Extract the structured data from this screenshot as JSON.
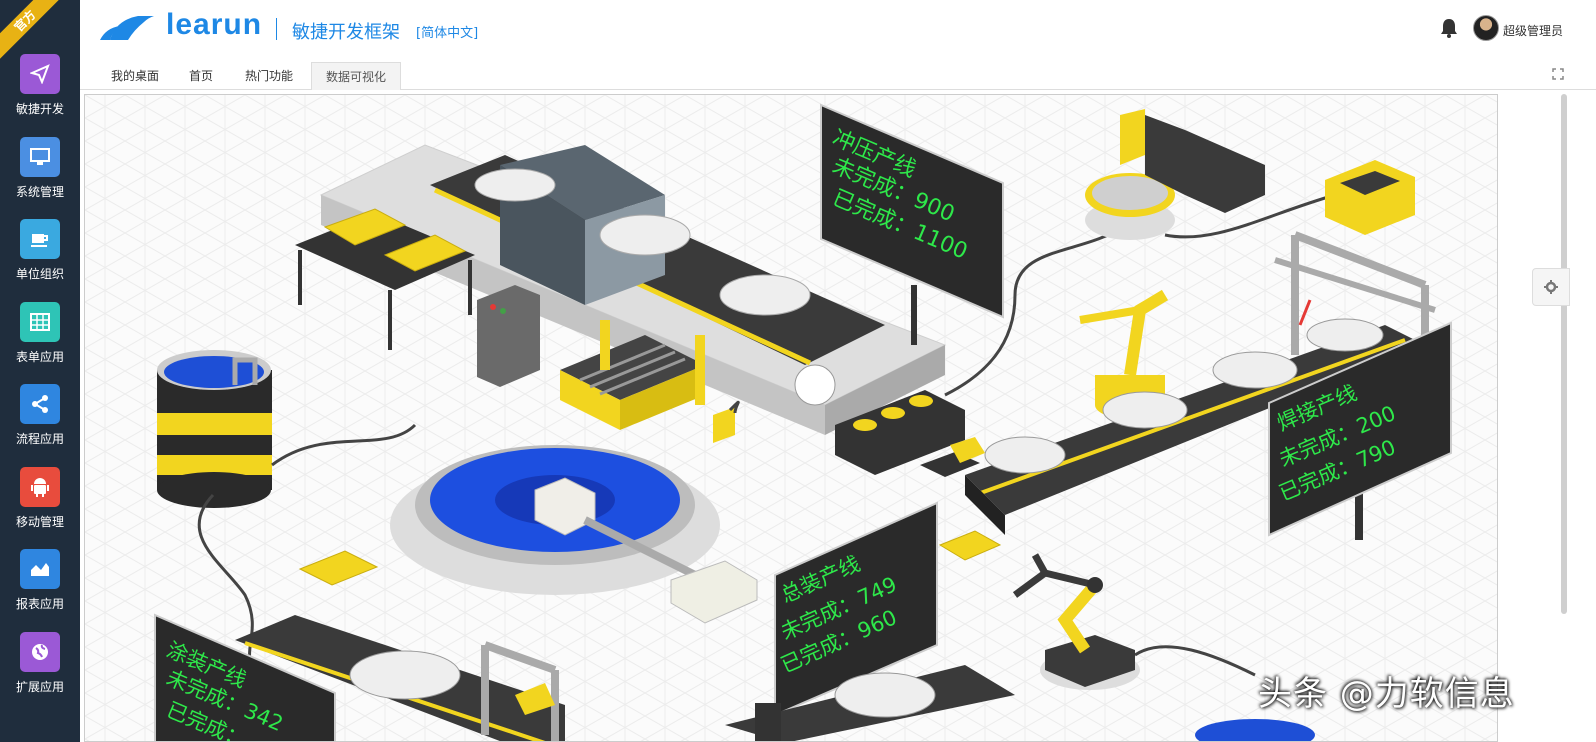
{
  "sidebar": {
    "ribbon": "官方",
    "items": [
      {
        "label": "敏捷开发",
        "icon": "paper-plane-icon",
        "color": "#9b59d6"
      },
      {
        "label": "系统管理",
        "icon": "monitor-icon",
        "color": "#4b8fe2"
      },
      {
        "label": "单位组织",
        "icon": "coffee-cup-icon",
        "color": "#3aa9e0"
      },
      {
        "label": "表单应用",
        "icon": "table-icon",
        "color": "#2ec4b6"
      },
      {
        "label": "流程应用",
        "icon": "share-icon",
        "color": "#2f86e0"
      },
      {
        "label": "移动管理",
        "icon": "android-icon",
        "color": "#e84c3d"
      },
      {
        "label": "报表应用",
        "icon": "area-chart-icon",
        "color": "#2f86e0"
      },
      {
        "label": "扩展应用",
        "icon": "globe-icon",
        "color": "#9b59d6"
      }
    ]
  },
  "header": {
    "logo": "learun",
    "title": "敏捷开发框架",
    "language": "[简体中文]",
    "username": "超级管理员"
  },
  "tabs": [
    {
      "label": "我的桌面",
      "active": false
    },
    {
      "label": "首页",
      "active": false
    },
    {
      "label": "热门功能",
      "active": false
    },
    {
      "label": "数据可视化",
      "active": true
    }
  ],
  "boards": {
    "stamping": {
      "title": "冲压产线",
      "unfinished": "未完成：900",
      "finished": "已完成：1100"
    },
    "welding": {
      "title": "焊接产线",
      "unfinished": "未完成：200",
      "finished": "已完成：790"
    },
    "assembly": {
      "title": "总装产线",
      "unfinished": "未完成：749",
      "finished": "已完成：960"
    },
    "painting": {
      "title": "涂装产线",
      "unfinished": "未完成：342",
      "finished": "已完成："
    }
  },
  "watermark": "头条 @力软信息",
  "colors": {
    "accent": "#1e88e5",
    "sidebar_bg": "#1f2d3d",
    "board_text": "#2ee84a",
    "machine_yellow": "#f2d51f"
  }
}
